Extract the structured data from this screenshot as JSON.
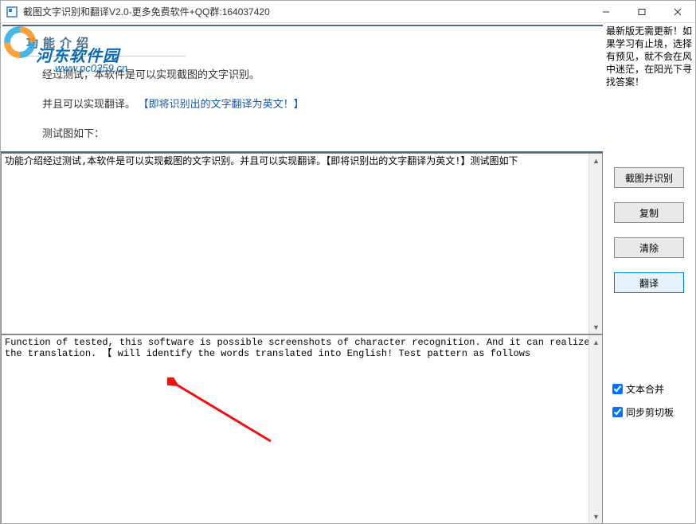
{
  "titlebar": {
    "title": "截图文字识别和翻译V2.0-更多免费软件+QQ群:164037420"
  },
  "watermark": {
    "line1": "河东软件园",
    "line2": "www.pc0359.cn"
  },
  "promo": "最新版无需更新！如果学习有止境，选择有预见，就不会在风中迷茫，在阳光下寻找答案！",
  "screenshot": {
    "section_title": "功能介绍",
    "line1": "经过测试，本软件是可以实现截图的文字识别。",
    "line2_a": "并且可以实现翻译。 ",
    "line2_b": "【即将识别出的文字翻译为英文！】",
    "line3": "测试图如下："
  },
  "recognized_text": "功能介绍经过测试,本软件是可以实现截图的文字识别。并且可以实现翻译。【即将识别出的文字翻译为英文!】测试图如下",
  "translated_text": "Function of tested, this software is possible screenshots of character recognition. And it can realize the translation. 【 will identify the words translated into English! Test pattern as follows",
  "buttons": {
    "capture": "截图并识别",
    "copy": "复制",
    "clear": "清除",
    "translate": "翻译"
  },
  "checkboxes": {
    "merge_text": "文本合并",
    "sync_clipboard": "同步剪切板"
  }
}
